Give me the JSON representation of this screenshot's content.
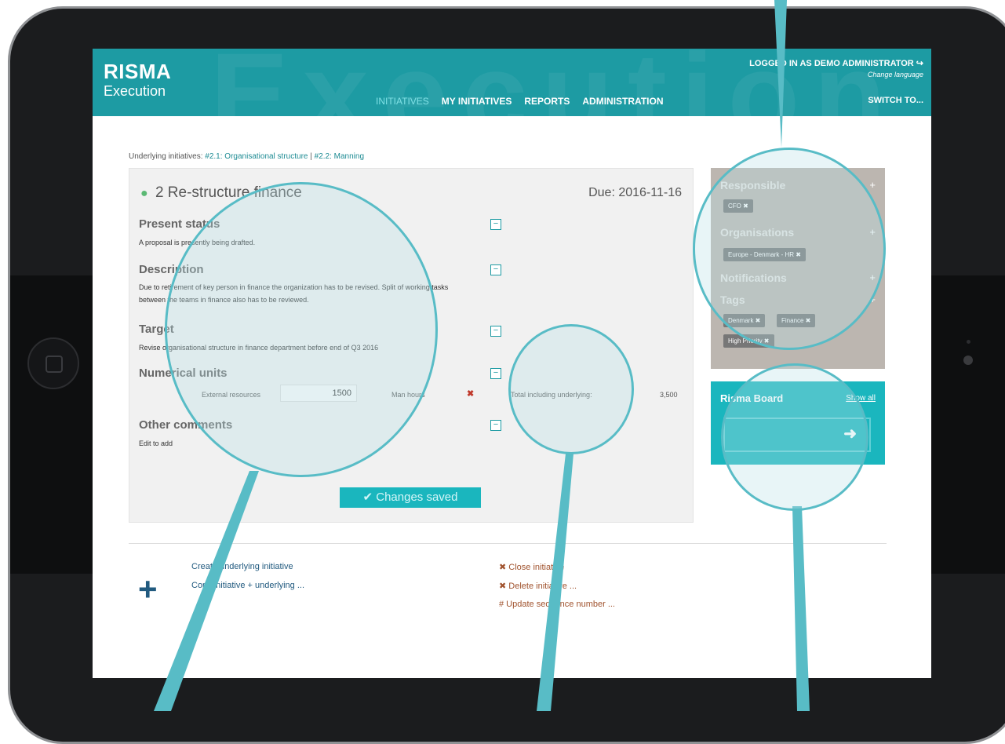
{
  "header": {
    "logo_title": "RISMA",
    "logo_subtitle": "Execution",
    "watermark": "Execution",
    "nav": [
      "INITIATIVES",
      "MY INITIATIVES",
      "REPORTS",
      "ADMINISTRATION"
    ],
    "login": "LOGGED IN AS DEMO ADMINISTRATOR ↪",
    "change_language": "Change language",
    "switch_to": "SWITCH TO..."
  },
  "breadcrumb": {
    "prefix": "Underlying initiatives:",
    "link1": "#2.1: Organisational structure",
    "separator": "|",
    "link2": "#2.2: Manning"
  },
  "initiative": {
    "status_dot": "●",
    "title": "2 Re-structure finance",
    "due": "Due: 2016-11-16",
    "present_status_heading": "Present status",
    "present_status_text": "A proposal is presently being drafted.",
    "description_heading": "Description",
    "description_text_1": "Due to retirement of key person in finance the organization has to be revised. Split of working tasks",
    "description_text_2": "between the teams in finance also has to be reviewed.",
    "target_heading": "Target",
    "target_text": "Revise organisational structure in finance department before end of Q3 2016",
    "numerical_heading": "Numerical units",
    "numerical_label": "External resources",
    "numerical_value": "1500",
    "numerical_unit": "Man hours",
    "remove_icon": "✖",
    "total_label": "Total including underlying:",
    "total_value": "3,500",
    "other_heading": "Other comments",
    "other_text": "Edit to add",
    "collapse_symbol": "−",
    "saved_label": "✔ Changes saved"
  },
  "sidebar": {
    "responsible": "Responsible",
    "responsible_tags": [
      "CFO ✖"
    ],
    "organisations": "Organisations",
    "organisation_tags": [
      "Europe - Denmark - HR ✖"
    ],
    "notifications": "Notifications",
    "tags": "Tags",
    "tag_items": [
      "Denmark ✖",
      "Finance ✖",
      "High Priority ✖"
    ],
    "add_symbol": "+"
  },
  "board": {
    "title": "Risma Board",
    "show_all": "Show all",
    "arrow": "➜"
  },
  "actions": {
    "add_symbol": "+",
    "create": "Create underlying initiative",
    "copy": "Copy initiative + underlying ...",
    "close": "✖ Close initiative",
    "delete": "✖ Delete initiative ...",
    "sequence": "# Update sequence number ..."
  },
  "colors": {
    "brand_teal": "#1d9ba3",
    "lens_stroke": "#58bcc6",
    "sidebar_bg": "#bcb6b0",
    "action_red": "#c0392b"
  }
}
